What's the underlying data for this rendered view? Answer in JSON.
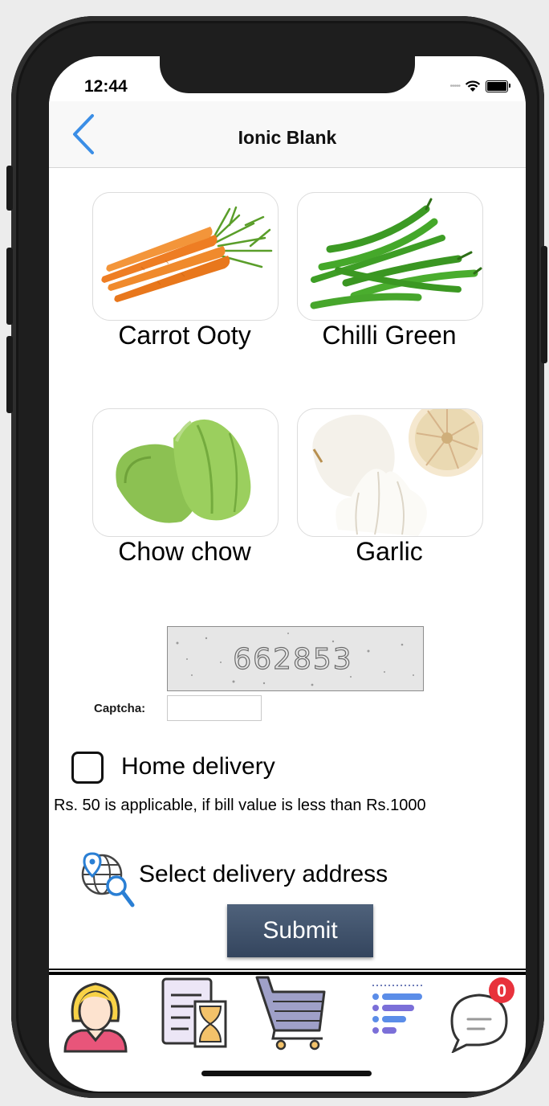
{
  "status_bar": {
    "time": "12:44"
  },
  "navbar": {
    "title": "Ionic Blank"
  },
  "products": [
    {
      "name": "Carrot Ooty"
    },
    {
      "name": "Chilli Green"
    },
    {
      "name": "Chow chow"
    },
    {
      "name": "Garlic"
    }
  ],
  "captcha": {
    "code": "662853",
    "label": "Captcha:",
    "value": ""
  },
  "delivery": {
    "checkbox_label": "Home delivery",
    "checked": false,
    "note": "Rs. 50 is applicable, if bill value is less than Rs.1000",
    "address_link": "Select delivery address"
  },
  "form": {
    "submit_label": "Submit"
  },
  "tabs": [
    {
      "icon": "user-profile-icon"
    },
    {
      "icon": "order-history-icon"
    },
    {
      "icon": "shopping-cart-icon"
    },
    {
      "icon": "list-icon"
    },
    {
      "icon": "chat-icon",
      "badge": "0"
    }
  ],
  "colors": {
    "accent": "#3b8ee6",
    "submit": "#3f5068",
    "badge": "#e8323c"
  }
}
